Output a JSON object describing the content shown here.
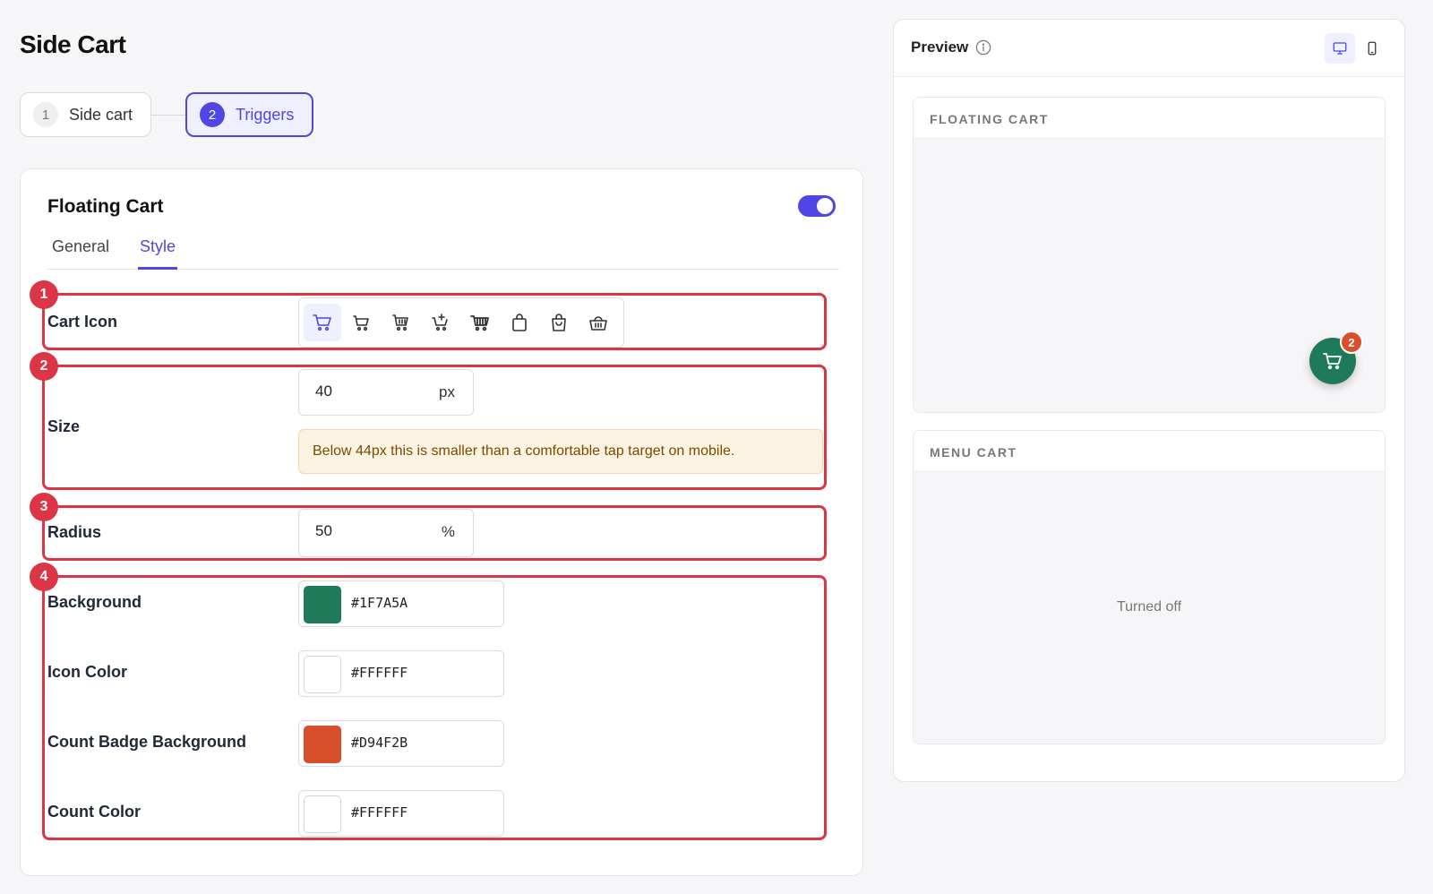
{
  "page": {
    "title": "Side Cart"
  },
  "steps": [
    {
      "num": "1",
      "label": "Side cart"
    },
    {
      "num": "2",
      "label": "Triggers"
    }
  ],
  "floating_cart": {
    "title": "Floating Cart",
    "enabled": true,
    "tabs": [
      "General",
      "Style"
    ],
    "active_tab": "Style"
  },
  "annotations": [
    "1",
    "2",
    "3",
    "4"
  ],
  "cart_icon": {
    "label": "Cart Icon",
    "options": [
      "cart-icon",
      "cart-outline-icon",
      "cart-basket-icon",
      "cart-plus-icon",
      "cart-filled-icon",
      "bag-icon",
      "shopping-bag-icon",
      "basket-icon"
    ],
    "selected": "cart-icon"
  },
  "size": {
    "label": "Size",
    "value": "40",
    "unit": "px",
    "warning": "Below 44px this is smaller than a comfortable tap target on mobile."
  },
  "radius": {
    "label": "Radius",
    "value": "50",
    "unit": "%"
  },
  "colors": {
    "background": {
      "label": "Background",
      "value": "#1F7A5A",
      "hex": "#1F7A5A"
    },
    "icon_color": {
      "label": "Icon Color",
      "value": "#FFFFFF",
      "hex": "#FFFFFF"
    },
    "badge_bg": {
      "label": "Count Badge Background",
      "value": "#D94F2B",
      "hex": "#D94F2B"
    },
    "count_color": {
      "label": "Count Color",
      "value": "#FFFFFF",
      "hex": "#FFFFFF"
    }
  },
  "preview": {
    "title": "Preview",
    "devices": [
      "desktop-icon",
      "mobile-icon"
    ],
    "active_device": "desktop-icon",
    "floating_cart_label": "FLOATING CART",
    "menu_cart_label": "MENU CART",
    "cart_count": "2",
    "menu_cart_status": "Turned off"
  }
}
